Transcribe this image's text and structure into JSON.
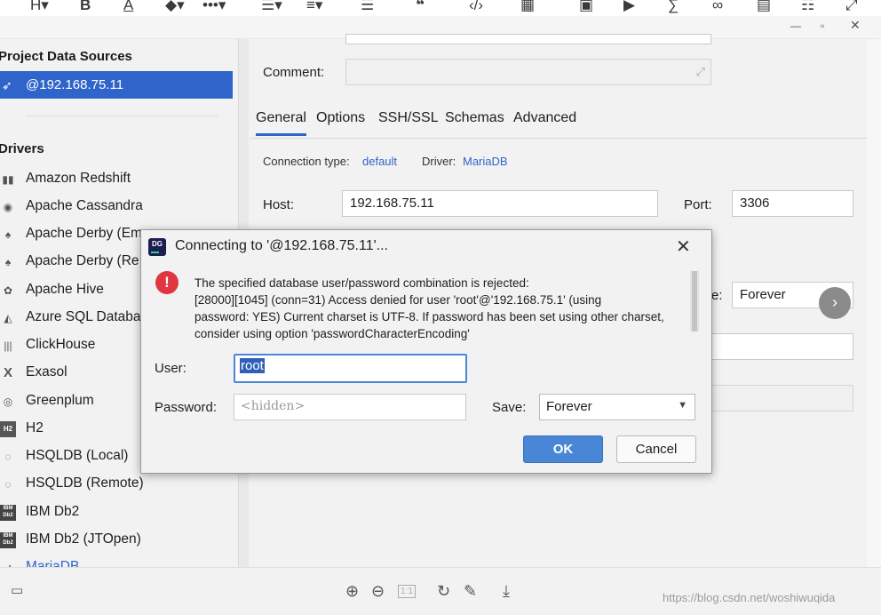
{
  "toolbar": {
    "icons": [
      "heading-icon",
      "bold-icon",
      "text-color-icon",
      "fill-color-icon",
      "more-icon",
      "bullet-list-icon",
      "align-icon",
      "indent-icon",
      "quote-icon",
      "code-icon",
      "table-icon",
      "image-icon",
      "video-icon",
      "formula-icon",
      "link-icon",
      "chart-icon",
      "list-icon",
      "expand-icon"
    ]
  },
  "left_panel": {
    "project_header": "Project Data Sources",
    "selected_source": "@192.168.75.11",
    "drivers_header": "Drivers",
    "drivers": [
      "Amazon Redshift",
      "Apache Cassandra",
      "Apache Derby (Em",
      "Apache Derby (Re",
      "Apache Hive",
      "Azure SQL Databa",
      "ClickHouse",
      "Exasol",
      "Greenplum",
      "H2",
      "HSQLDB (Local)",
      "HSQLDB (Remote)",
      "IBM Db2",
      "IBM Db2 (JTOpen)",
      "MariaDB"
    ]
  },
  "right_panel": {
    "comment_label": "Comment:",
    "tabs": [
      "General",
      "Options",
      "SSH/SSL",
      "Schemas",
      "Advanced"
    ],
    "active_tab": "General",
    "connection_type_label": "Connection type:",
    "connection_type_value": "default",
    "driver_label": "Driver:",
    "driver_value": "MariaDB",
    "host_label": "Host:",
    "host_value": "192.168.75.11",
    "port_label": "Port:",
    "port_value": "3306",
    "save_partial_label": "e:",
    "save_value": "Forever"
  },
  "dialog": {
    "logo_text": "DG",
    "title": "Connecting to '@192.168.75.11'...",
    "error_lines": [
      "The specified database user/password combination is rejected:",
      "[28000][1045] (conn=31) Access denied for user 'root'@'192.168.75.1' (using",
      "password: YES) Current charset is UTF-8. If password has been set using other charset,",
      "consider using option 'passwordCharacterEncoding'"
    ],
    "user_label": "User:",
    "user_value": "root",
    "password_label": "Password:",
    "password_placeholder": "<hidden>",
    "save_label": "Save:",
    "save_value": "Forever",
    "ok_label": "OK",
    "cancel_label": "Cancel"
  },
  "watermark": "https://blog.csdn.net/woshiwuqida",
  "colors": {
    "accent": "#2f65ca",
    "ok_button": "#4a86d6",
    "error_icon": "#e0363f"
  }
}
